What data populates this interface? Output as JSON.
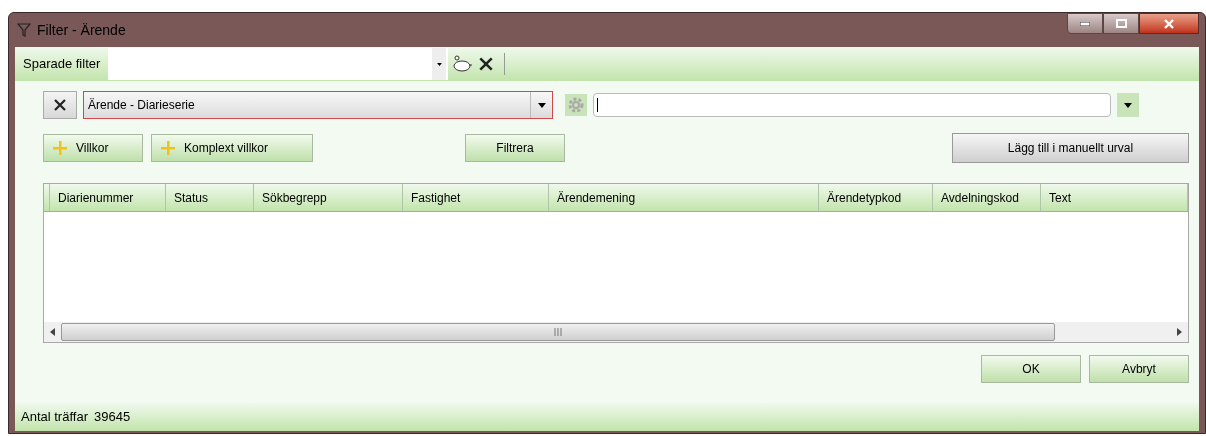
{
  "window": {
    "title": "Filter - Ärende"
  },
  "saved_filter": {
    "label": "Sparade filter"
  },
  "condition": {
    "field": "Ärende - Diarieserie"
  },
  "buttons": {
    "add_condition": "Villkor",
    "add_complex": "Komplext villkor",
    "filter": "Filtrera",
    "add_manual": "Lägg till i manuellt urval"
  },
  "table": {
    "columns": [
      "Diarienummer",
      "Status",
      "Sökbegrepp",
      "Fastighet",
      "Ärendemening",
      "Ärendetypkod",
      "Avdelningskod",
      "Text"
    ]
  },
  "dialog_buttons": [
    "OK",
    "Avbryt"
  ],
  "status_bar": {
    "label": "Antal träffar",
    "count": "39645"
  }
}
